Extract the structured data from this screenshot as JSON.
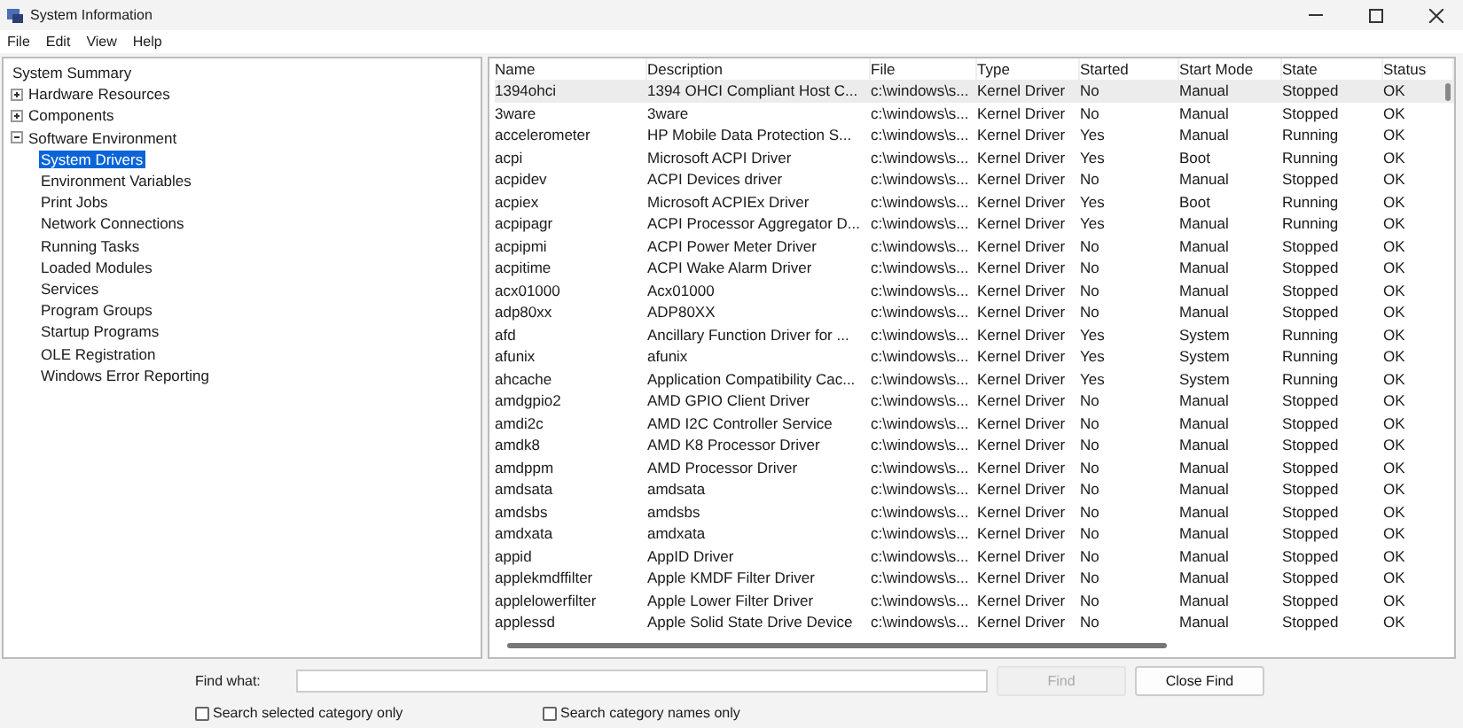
{
  "window": {
    "title": "System Information"
  },
  "menu": [
    "File",
    "Edit",
    "View",
    "Help"
  ],
  "tree": [
    {
      "label": "System Summary",
      "selected": false
    },
    {
      "label": "Hardware Resources",
      "selected": false,
      "expanded": false
    },
    {
      "label": "Components",
      "selected": false,
      "expanded": false
    },
    {
      "label": "Software Environment",
      "selected": false,
      "expanded": true,
      "children": [
        {
          "label": "System Drivers",
          "selected": true
        },
        {
          "label": "Environment Variables",
          "selected": false
        },
        {
          "label": "Print Jobs",
          "selected": false
        },
        {
          "label": "Network Connections",
          "selected": false
        },
        {
          "label": "Running Tasks",
          "selected": false
        },
        {
          "label": "Loaded Modules",
          "selected": false
        },
        {
          "label": "Services",
          "selected": false
        },
        {
          "label": "Program Groups",
          "selected": false
        },
        {
          "label": "Startup Programs",
          "selected": false
        },
        {
          "label": "OLE Registration",
          "selected": false
        },
        {
          "label": "Windows Error Reporting",
          "selected": false
        }
      ]
    }
  ],
  "table": {
    "columns": [
      "Name",
      "Description",
      "File",
      "Type",
      "Started",
      "Start Mode",
      "State",
      "Status"
    ],
    "rows": [
      {
        "selected": true,
        "cells": [
          "1394ohci",
          "1394 OHCI Compliant Host C...",
          "c:\\windows\\s...",
          "Kernel Driver",
          "No",
          "Manual",
          "Stopped",
          "OK"
        ]
      },
      {
        "selected": false,
        "cells": [
          "3ware",
          "3ware",
          "c:\\windows\\s...",
          "Kernel Driver",
          "No",
          "Manual",
          "Stopped",
          "OK"
        ]
      },
      {
        "selected": false,
        "cells": [
          "accelerometer",
          "HP Mobile Data Protection S...",
          "c:\\windows\\s...",
          "Kernel Driver",
          "Yes",
          "Manual",
          "Running",
          "OK"
        ]
      },
      {
        "selected": false,
        "cells": [
          "acpi",
          "Microsoft ACPI Driver",
          "c:\\windows\\s...",
          "Kernel Driver",
          "Yes",
          "Boot",
          "Running",
          "OK"
        ]
      },
      {
        "selected": false,
        "cells": [
          "acpidev",
          "ACPI Devices driver",
          "c:\\windows\\s...",
          "Kernel Driver",
          "No",
          "Manual",
          "Stopped",
          "OK"
        ]
      },
      {
        "selected": false,
        "cells": [
          "acpiex",
          "Microsoft ACPIEx Driver",
          "c:\\windows\\s...",
          "Kernel Driver",
          "Yes",
          "Boot",
          "Running",
          "OK"
        ]
      },
      {
        "selected": false,
        "cells": [
          "acpipagr",
          "ACPI Processor Aggregator D...",
          "c:\\windows\\s...",
          "Kernel Driver",
          "Yes",
          "Manual",
          "Running",
          "OK"
        ]
      },
      {
        "selected": false,
        "cells": [
          "acpipmi",
          "ACPI Power Meter Driver",
          "c:\\windows\\s...",
          "Kernel Driver",
          "No",
          "Manual",
          "Stopped",
          "OK"
        ]
      },
      {
        "selected": false,
        "cells": [
          "acpitime",
          "ACPI Wake Alarm Driver",
          "c:\\windows\\s...",
          "Kernel Driver",
          "No",
          "Manual",
          "Stopped",
          "OK"
        ]
      },
      {
        "selected": false,
        "cells": [
          "acx01000",
          "Acx01000",
          "c:\\windows\\s...",
          "Kernel Driver",
          "No",
          "Manual",
          "Stopped",
          "OK"
        ]
      },
      {
        "selected": false,
        "cells": [
          "adp80xx",
          "ADP80XX",
          "c:\\windows\\s...",
          "Kernel Driver",
          "No",
          "Manual",
          "Stopped",
          "OK"
        ]
      },
      {
        "selected": false,
        "cells": [
          "afd",
          "Ancillary Function Driver for ...",
          "c:\\windows\\s...",
          "Kernel Driver",
          "Yes",
          "System",
          "Running",
          "OK"
        ]
      },
      {
        "selected": false,
        "cells": [
          "afunix",
          "afunix",
          "c:\\windows\\s...",
          "Kernel Driver",
          "Yes",
          "System",
          "Running",
          "OK"
        ]
      },
      {
        "selected": false,
        "cells": [
          "ahcache",
          "Application Compatibility Cac...",
          "c:\\windows\\s...",
          "Kernel Driver",
          "Yes",
          "System",
          "Running",
          "OK"
        ]
      },
      {
        "selected": false,
        "cells": [
          "amdgpio2",
          "AMD GPIO Client Driver",
          "c:\\windows\\s...",
          "Kernel Driver",
          "No",
          "Manual",
          "Stopped",
          "OK"
        ]
      },
      {
        "selected": false,
        "cells": [
          "amdi2c",
          "AMD I2C Controller Service",
          "c:\\windows\\s...",
          "Kernel Driver",
          "No",
          "Manual",
          "Stopped",
          "OK"
        ]
      },
      {
        "selected": false,
        "cells": [
          "amdk8",
          "AMD K8 Processor Driver",
          "c:\\windows\\s...",
          "Kernel Driver",
          "No",
          "Manual",
          "Stopped",
          "OK"
        ]
      },
      {
        "selected": false,
        "cells": [
          "amdppm",
          "AMD Processor Driver",
          "c:\\windows\\s...",
          "Kernel Driver",
          "No",
          "Manual",
          "Stopped",
          "OK"
        ]
      },
      {
        "selected": false,
        "cells": [
          "amdsata",
          "amdsata",
          "c:\\windows\\s...",
          "Kernel Driver",
          "No",
          "Manual",
          "Stopped",
          "OK"
        ]
      },
      {
        "selected": false,
        "cells": [
          "amdsbs",
          "amdsbs",
          "c:\\windows\\s...",
          "Kernel Driver",
          "No",
          "Manual",
          "Stopped",
          "OK"
        ]
      },
      {
        "selected": false,
        "cells": [
          "amdxata",
          "amdxata",
          "c:\\windows\\s...",
          "Kernel Driver",
          "No",
          "Manual",
          "Stopped",
          "OK"
        ]
      },
      {
        "selected": false,
        "cells": [
          "appid",
          "AppID Driver",
          "c:\\windows\\s...",
          "Kernel Driver",
          "No",
          "Manual",
          "Stopped",
          "OK"
        ]
      },
      {
        "selected": false,
        "cells": [
          "applekmdffilter",
          "Apple KMDF Filter Driver",
          "c:\\windows\\s...",
          "Kernel Driver",
          "No",
          "Manual",
          "Stopped",
          "OK"
        ]
      },
      {
        "selected": false,
        "cells": [
          "applelowerfilter",
          "Apple Lower Filter Driver",
          "c:\\windows\\s...",
          "Kernel Driver",
          "No",
          "Manual",
          "Stopped",
          "OK"
        ]
      },
      {
        "selected": false,
        "cells": [
          "applessd",
          "Apple Solid State Drive Device",
          "c:\\windows\\s...",
          "Kernel Driver",
          "No",
          "Manual",
          "Stopped",
          "OK"
        ]
      }
    ]
  },
  "find": {
    "label": "Find what:",
    "find_button": {
      "label": "Find",
      "disabled": true
    },
    "close_button": "Close Find",
    "options": [
      {
        "label": "Search selected category only",
        "checked": false
      },
      {
        "label": "Search category names only",
        "checked": false
      }
    ]
  }
}
